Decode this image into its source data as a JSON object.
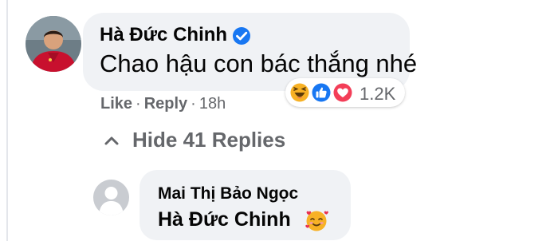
{
  "comment": {
    "author": "Hà Đức Chinh",
    "text": "Chao hậu con bác thắng nhé",
    "verified_icon": "verified-badge-icon",
    "avatar_icon": "profile-photo-player",
    "reactions": {
      "icons": [
        "haha-reaction-icon",
        "like-reaction-icon",
        "love-reaction-icon"
      ],
      "count": "1.2K"
    },
    "actions": {
      "like": "Like",
      "reply": "Reply",
      "separator": "·",
      "time": "18h"
    }
  },
  "replies_toggle": {
    "icon": "chevron-up-icon",
    "label": "Hide 41 Replies"
  },
  "reply": {
    "author": "Mai Thị Bảo Ngọc",
    "text": "Hà Đức Chinh",
    "emoji_icon": "smiling-face-with-hearts-icon",
    "avatar_icon": "default-avatar-icon"
  },
  "colors": {
    "bubble": "#f0f2f5",
    "text": "#050505",
    "muted": "#65676b",
    "verified": "#1877f2",
    "like": "#1877f2",
    "love": "#f33e58",
    "haha": "#f7b125"
  }
}
